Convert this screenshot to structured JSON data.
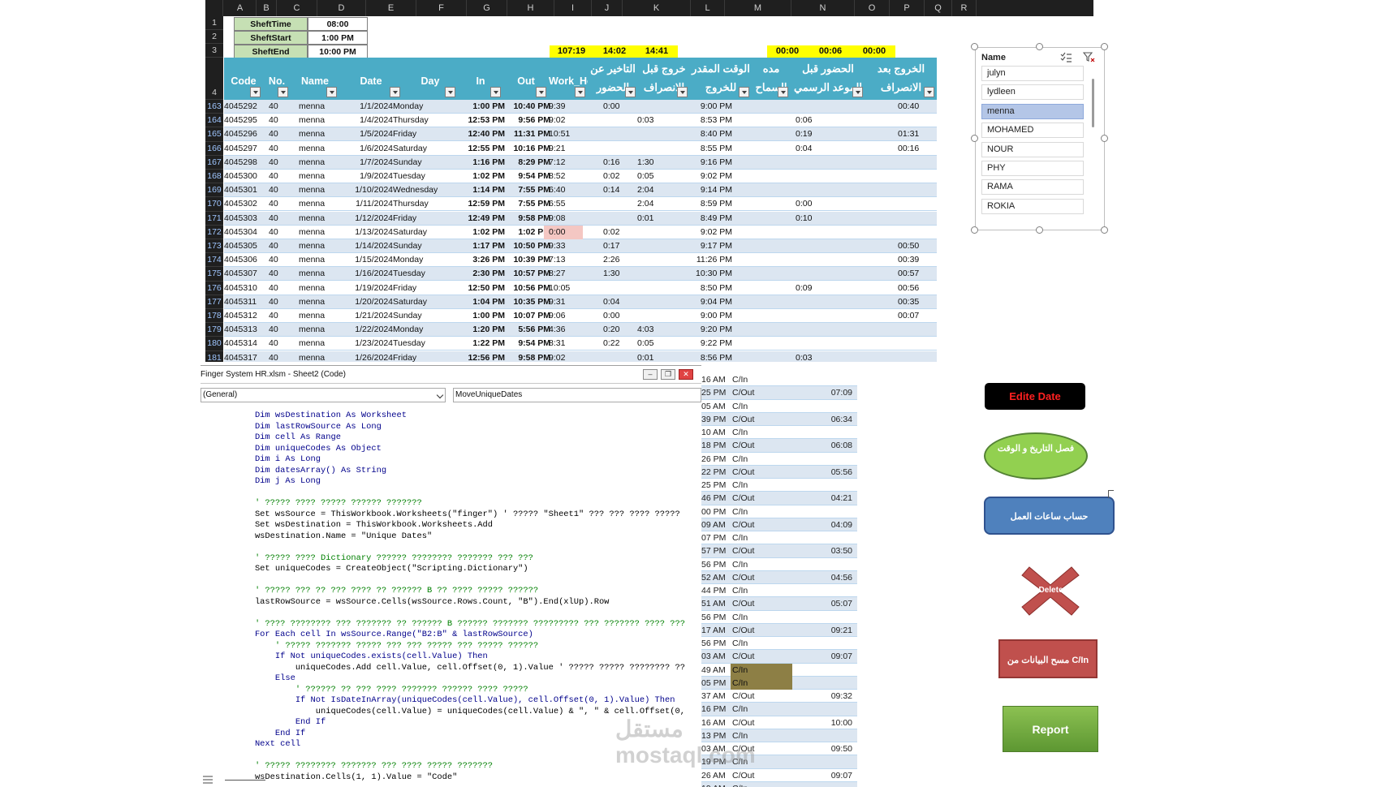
{
  "sheet": {
    "columns": [
      "A",
      "B",
      "C",
      "D",
      "E",
      "F",
      "G",
      "H",
      "I",
      "J",
      "K",
      "L",
      "M",
      "N",
      "O",
      "P",
      "Q",
      "R"
    ],
    "shift": [
      {
        "row": "1",
        "label": "SheftTime",
        "value": "08:00"
      },
      {
        "row": "2",
        "label": "SheftStart",
        "value": "1:00 PM"
      },
      {
        "row": "3",
        "label": "SheftEnd",
        "value": "10:00 PM"
      }
    ],
    "totals": {
      "h": "107:19",
      "i": "14:02",
      "j": "14:41",
      "l": "00:00",
      "m": "00:06",
      "n": "00:00"
    },
    "header_row": "4",
    "headers": {
      "code": "Code",
      "no": "No.",
      "name": "Name",
      "date": "Date",
      "day": "Day",
      "in": "In",
      "out": "Out",
      "work": "Work_Hours",
      "late": "التاخير عن الحضور",
      "early": "خروج قبل الانصراف",
      "expected": "الوقت المقدر للخروج",
      "allow": "مده السماح",
      "before": "الحضور قبل الموعد الرسمي",
      "after": "الخروج بعد الانصراف"
    },
    "rows": [
      {
        "r": "163",
        "code": "4045292",
        "no": "40",
        "name": "menna",
        "date": "1/1/2024",
        "day": "Monday",
        "in": "1:00 PM",
        "out": "10:40 PM",
        "work": "9:39",
        "late": "0:00",
        "early": "",
        "exp": "9:00 PM",
        "before": "",
        "after": "00:40"
      },
      {
        "r": "164",
        "code": "4045295",
        "no": "40",
        "name": "menna",
        "date": "1/4/2024",
        "day": "Thursday",
        "in": "12:53 PM",
        "out": "9:56 PM",
        "work": "9:02",
        "late": "",
        "early": "0:03",
        "exp": "8:53 PM",
        "before": "0:06",
        "after": ""
      },
      {
        "r": "165",
        "code": "4045296",
        "no": "40",
        "name": "menna",
        "date": "1/5/2024",
        "day": "Friday",
        "in": "12:40 PM",
        "out": "11:31 PM",
        "work": "10:51",
        "late": "",
        "early": "",
        "exp": "8:40 PM",
        "before": "0:19",
        "after": "01:31"
      },
      {
        "r": "166",
        "code": "4045297",
        "no": "40",
        "name": "menna",
        "date": "1/6/2024",
        "day": "Saturday",
        "in": "12:55 PM",
        "out": "10:16 PM",
        "work": "9:21",
        "late": "",
        "early": "",
        "exp": "8:55 PM",
        "before": "0:04",
        "after": "00:16"
      },
      {
        "r": "167",
        "code": "4045298",
        "no": "40",
        "name": "menna",
        "date": "1/7/2024",
        "day": "Sunday",
        "in": "1:16 PM",
        "out": "8:29 PM",
        "work": "7:12",
        "late": "0:16",
        "early": "1:30",
        "exp": "9:16 PM",
        "before": "",
        "after": ""
      },
      {
        "r": "168",
        "code": "4045300",
        "no": "40",
        "name": "menna",
        "date": "1/9/2024",
        "day": "Tuesday",
        "in": "1:02 PM",
        "out": "9:54 PM",
        "work": "8:52",
        "late": "0:02",
        "early": "0:05",
        "exp": "9:02 PM",
        "before": "",
        "after": ""
      },
      {
        "r": "169",
        "code": "4045301",
        "no": "40",
        "name": "menna",
        "date": "1/10/2024",
        "day": "Wednesday",
        "in": "1:14 PM",
        "out": "7:55 PM",
        "work": "6:40",
        "late": "0:14",
        "early": "2:04",
        "exp": "9:14 PM",
        "before": "",
        "after": ""
      },
      {
        "r": "170",
        "code": "4045302",
        "no": "40",
        "name": "menna",
        "date": "1/11/2024",
        "day": "Thursday",
        "in": "12:59 PM",
        "out": "7:55 PM",
        "work": "6:55",
        "late": "",
        "early": "2:04",
        "exp": "8:59 PM",
        "before": "0:00",
        "after": ""
      },
      {
        "r": "171",
        "code": "4045303",
        "no": "40",
        "name": "menna",
        "date": "1/12/2024",
        "day": "Friday",
        "in": "12:49 PM",
        "out": "9:58 PM",
        "work": "9:08",
        "late": "",
        "early": "0:01",
        "exp": "8:49 PM",
        "before": "0:10",
        "after": ""
      },
      {
        "r": "172",
        "code": "4045304",
        "no": "40",
        "name": "menna",
        "date": "1/13/2024",
        "day": "Saturday",
        "in": "1:02 PM",
        "out": "1:02 PM",
        "work": "0:00",
        "late": "0:02",
        "early": "",
        "exp": "9:02 PM",
        "before": "",
        "after": "",
        "flag": true
      },
      {
        "r": "173",
        "code": "4045305",
        "no": "40",
        "name": "menna",
        "date": "1/14/2024",
        "day": "Sunday",
        "in": "1:17 PM",
        "out": "10:50 PM",
        "work": "9:33",
        "late": "0:17",
        "early": "",
        "exp": "9:17 PM",
        "before": "",
        "after": "00:50"
      },
      {
        "r": "174",
        "code": "4045306",
        "no": "40",
        "name": "menna",
        "date": "1/15/2024",
        "day": "Monday",
        "in": "3:26 PM",
        "out": "10:39 PM",
        "work": "7:13",
        "late": "2:26",
        "early": "",
        "exp": "11:26 PM",
        "before": "",
        "after": "00:39"
      },
      {
        "r": "175",
        "code": "4045307",
        "no": "40",
        "name": "menna",
        "date": "1/16/2024",
        "day": "Tuesday",
        "in": "2:30 PM",
        "out": "10:57 PM",
        "work": "8:27",
        "late": "1:30",
        "early": "",
        "exp": "10:30 PM",
        "before": "",
        "after": "00:57"
      },
      {
        "r": "176",
        "code": "4045310",
        "no": "40",
        "name": "menna",
        "date": "1/19/2024",
        "day": "Friday",
        "in": "12:50 PM",
        "out": "10:56 PM",
        "work": "10:05",
        "late": "",
        "early": "",
        "exp": "8:50 PM",
        "before": "0:09",
        "after": "00:56"
      },
      {
        "r": "177",
        "code": "4045311",
        "no": "40",
        "name": "menna",
        "date": "1/20/2024",
        "day": "Saturday",
        "in": "1:04 PM",
        "out": "10:35 PM",
        "work": "9:31",
        "late": "0:04",
        "early": "",
        "exp": "9:04 PM",
        "before": "",
        "after": "00:35"
      },
      {
        "r": "178",
        "code": "4045312",
        "no": "40",
        "name": "menna",
        "date": "1/21/2024",
        "day": "Sunday",
        "in": "1:00 PM",
        "out": "10:07 PM",
        "work": "9:06",
        "late": "0:00",
        "early": "",
        "exp": "9:00 PM",
        "before": "",
        "after": "00:07"
      },
      {
        "r": "179",
        "code": "4045313",
        "no": "40",
        "name": "menna",
        "date": "1/22/2024",
        "day": "Monday",
        "in": "1:20 PM",
        "out": "5:56 PM",
        "work": "4:36",
        "late": "0:20",
        "early": "4:03",
        "exp": "9:20 PM",
        "before": "",
        "after": ""
      },
      {
        "r": "180",
        "code": "4045314",
        "no": "40",
        "name": "menna",
        "date": "1/23/2024",
        "day": "Tuesday",
        "in": "1:22 PM",
        "out": "9:54 PM",
        "work": "8:31",
        "late": "0:22",
        "early": "0:05",
        "exp": "9:22 PM",
        "before": "",
        "after": ""
      },
      {
        "r": "181",
        "code": "4045317",
        "no": "40",
        "name": "menna",
        "date": "1/26/2024",
        "day": "Friday",
        "in": "12:56 PM",
        "out": "9:58 PM",
        "work": "9:02",
        "late": "",
        "early": "0:01",
        "exp": "8:56 PM",
        "before": "0:03",
        "after": ""
      }
    ]
  },
  "slicer": {
    "title": "Name",
    "items": [
      "julyn",
      "lydleen",
      "menna",
      "MOHAMED",
      "NOUR",
      "PHY",
      "RAMA",
      "ROKIA"
    ],
    "selected": "menna"
  },
  "editor": {
    "title": "Finger System HR.xlsm - Sheet2 (Code)",
    "object_combo": "(General)",
    "proc_combo": "MoveUniqueDates",
    "code": [
      {
        "t": "    Dim wsDestination As Worksheet",
        "k": "kw"
      },
      {
        "t": "    Dim lastRowSource As Long",
        "k": "kw"
      },
      {
        "t": "    Dim cell As Range",
        "k": "kw"
      },
      {
        "t": "    Dim uniqueCodes As Object",
        "k": "kw"
      },
      {
        "t": "    Dim i As Long",
        "k": "kw"
      },
      {
        "t": "    Dim datesArray() As String",
        "k": "kw"
      },
      {
        "t": "    Dim j As Long",
        "k": "kw"
      },
      {
        "t": "",
        "k": ""
      },
      {
        "t": "    ' ????? ???? ????? ?????? ???????",
        "k": "cm"
      },
      {
        "t": "    Set wsSource = ThisWorkbook.Worksheets(\"finger\") ' ????? \"Sheet1\" ??? ??? ???? ?????",
        "k": ""
      },
      {
        "t": "    Set wsDestination = ThisWorkbook.Worksheets.Add",
        "k": ""
      },
      {
        "t": "    wsDestination.Name = \"Unique Dates\"",
        "k": ""
      },
      {
        "t": "",
        "k": ""
      },
      {
        "t": "    ' ????? ???? Dictionary ?????? ???????? ??????? ??? ???",
        "k": "cm"
      },
      {
        "t": "    Set uniqueCodes = CreateObject(\"Scripting.Dictionary\")",
        "k": ""
      },
      {
        "t": "",
        "k": ""
      },
      {
        "t": "    ' ????? ??? ?? ??? ???? ?? ?????? B ?? ???? ????? ??????",
        "k": "cm"
      },
      {
        "t": "    lastRowSource = wsSource.Cells(wsSource.Rows.Count, \"B\").End(xlUp).Row",
        "k": ""
      },
      {
        "t": "",
        "k": ""
      },
      {
        "t": "    ' ???? ???????? ??? ??????? ?? ?????? B ?????? ??????? ????????? ??? ??????? ???? ???",
        "k": "cm"
      },
      {
        "t": "    For Each cell In wsSource.Range(\"B2:B\" & lastRowSource)",
        "k": "kw"
      },
      {
        "t": "        ' ????? ??????? ????? ??? ??? ????? ??? ????? ??????",
        "k": "cm"
      },
      {
        "t": "        If Not uniqueCodes.exists(cell.Value) Then",
        "k": "kw"
      },
      {
        "t": "            uniqueCodes.Add cell.Value, cell.Offset(0, 1).Value ' ????? ????? ???????? ??",
        "k": ""
      },
      {
        "t": "        Else",
        "k": "kw"
      },
      {
        "t": "            ' ?????? ?? ??? ???? ??????? ?????? ???? ?????",
        "k": "cm"
      },
      {
        "t": "            If Not IsDateInArray(uniqueCodes(cell.Value), cell.Offset(0, 1).Value) Then",
        "k": "kw"
      },
      {
        "t": "                uniqueCodes(cell.Value) = uniqueCodes(cell.Value) & \", \" & cell.Offset(0,",
        "k": ""
      },
      {
        "t": "            End If",
        "k": "kw"
      },
      {
        "t": "        End If",
        "k": "kw"
      },
      {
        "t": "    Next cell",
        "k": "kw"
      },
      {
        "t": "",
        "k": ""
      },
      {
        "t": "    ' ????? ???????? ??????? ??? ???? ????? ???????",
        "k": "cm"
      },
      {
        "t": "    wsDestination.Cells(1, 1).Value = \"Code\"",
        "k": ""
      }
    ]
  },
  "timecol": [
    {
      "a": "16 AM",
      "b": "C/In",
      "d": ""
    },
    {
      "a": "25 PM",
      "b": "C/Out",
      "d": "07:09"
    },
    {
      "a": "05 AM",
      "b": "C/In",
      "d": ""
    },
    {
      "a": "39 PM",
      "b": "C/Out",
      "d": "06:34"
    },
    {
      "a": "10 AM",
      "b": "C/In",
      "d": ""
    },
    {
      "a": "18 PM",
      "b": "C/Out",
      "d": "06:08"
    },
    {
      "a": "26 PM",
      "b": "C/In",
      "d": ""
    },
    {
      "a": "22 PM",
      "b": "C/Out",
      "d": "05:56"
    },
    {
      "a": "25 PM",
      "b": "C/In",
      "d": ""
    },
    {
      "a": "46 PM",
      "b": "C/Out",
      "d": "04:21"
    },
    {
      "a": "00 PM",
      "b": "C/In",
      "d": ""
    },
    {
      "a": "09 AM",
      "b": "C/Out",
      "d": "04:09"
    },
    {
      "a": "07 PM",
      "b": "C/In",
      "d": ""
    },
    {
      "a": "57 PM",
      "b": "C/Out",
      "d": "03:50"
    },
    {
      "a": "56 PM",
      "b": "C/In",
      "d": ""
    },
    {
      "a": "52 AM",
      "b": "C/Out",
      "d": "04:56"
    },
    {
      "a": "44 PM",
      "b": "C/In",
      "d": ""
    },
    {
      "a": "51 AM",
      "b": "C/Out",
      "d": "05:07"
    },
    {
      "a": "56 PM",
      "b": "C/In",
      "d": ""
    },
    {
      "a": "17 AM",
      "b": "C/Out",
      "d": "09:21"
    },
    {
      "a": "56 PM",
      "b": "C/In",
      "d": ""
    },
    {
      "a": "03 AM",
      "b": "C/Out",
      "d": "09:07"
    },
    {
      "a": "49 AM",
      "b": "C/In",
      "d": "",
      "hl": true
    },
    {
      "a": "05 PM",
      "b": "C/In",
      "d": "",
      "hl": true
    },
    {
      "a": "37 AM",
      "b": "C/Out",
      "d": "09:32"
    },
    {
      "a": "16 PM",
      "b": "C/In",
      "d": ""
    },
    {
      "a": "16 AM",
      "b": "C/Out",
      "d": "10:00"
    },
    {
      "a": "13 PM",
      "b": "C/In",
      "d": ""
    },
    {
      "a": "03 AM",
      "b": "C/Out",
      "d": "09:50"
    },
    {
      "a": "19 PM",
      "b": "C/In",
      "d": ""
    },
    {
      "a": "26 AM",
      "b": "C/Out",
      "d": "09:07"
    },
    {
      "a": "19 AM",
      "b": "C/In",
      "d": ""
    }
  ],
  "buttons": {
    "edit_date": "Edite Date",
    "split": "فصل التاريخ و الوقت",
    "hours": "حساب ساعات العمل",
    "delete": "Delete",
    "clear": "C/In مسح البيانات من",
    "report": "Report"
  },
  "colors": {
    "header_blue": "#4bacc6",
    "row_band": "#dce6f1",
    "highlight_yellow": "#ffff00",
    "shift_green": "#c6e0b4"
  },
  "watermark": "مستقل mostaql.com"
}
